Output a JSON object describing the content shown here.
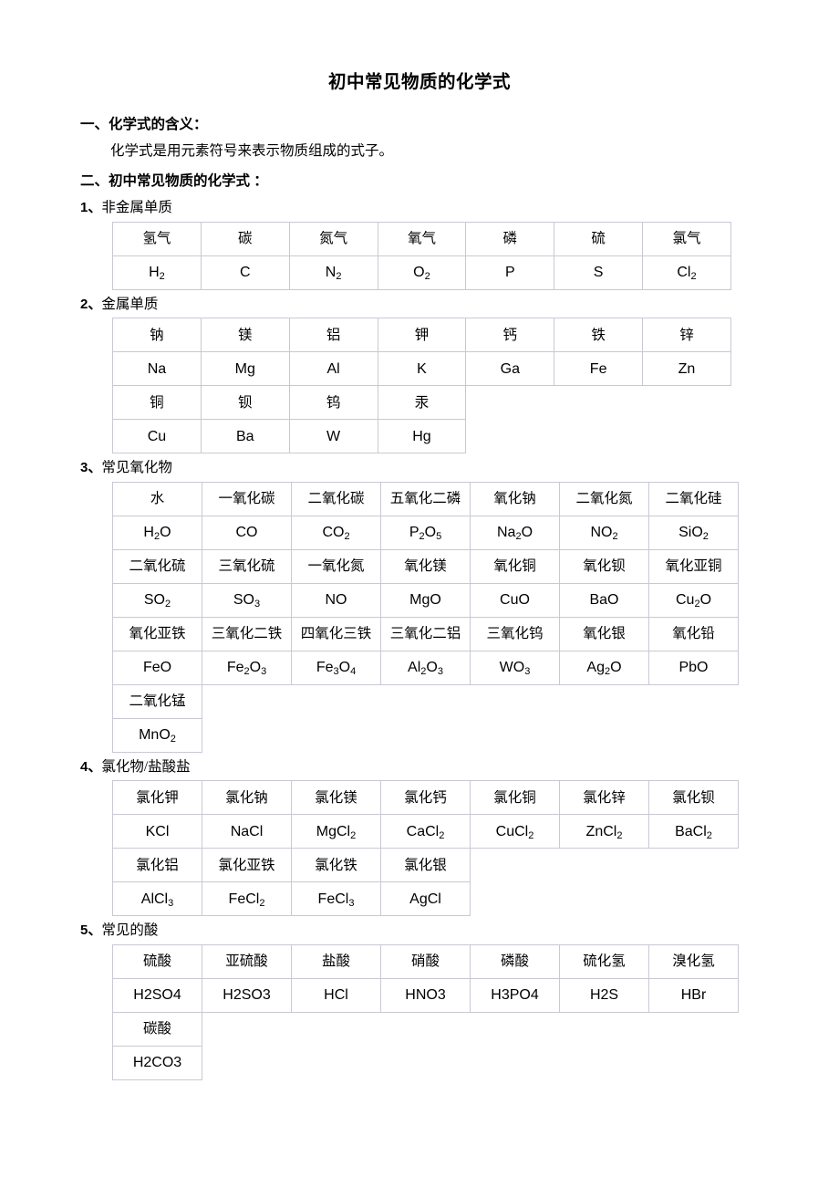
{
  "document": {
    "title": "初中常见物质的化学式",
    "sections": [
      {
        "heading": "一、化学式的含义：",
        "body": "化学式是用元素符号来表示物质组成的式子。"
      },
      {
        "heading": "二、初中常见物质的化学式 ："
      }
    ]
  },
  "groups": [
    {
      "number": "1、",
      "label": "非金属单质",
      "table_style": "wide",
      "rows": [
        {
          "names": [
            "氢气",
            "碳",
            "氮气",
            "氧气",
            "磷",
            "硫",
            "氯气"
          ],
          "formulas": [
            {
              "base": "H",
              "sub": "2"
            },
            {
              "base": "C",
              "sub": ""
            },
            {
              "base": "N",
              "sub": "2"
            },
            {
              "base": "O",
              "sub": "2"
            },
            {
              "base": "P",
              "sub": ""
            },
            {
              "base": "S",
              "sub": ""
            },
            {
              "base": "Cl",
              "sub": "2"
            }
          ]
        }
      ]
    },
    {
      "number": "2、",
      "label": "金属单质",
      "table_style": "wide",
      "rows": [
        {
          "names": [
            "钠",
            "镁",
            "铝",
            "钾",
            "钙",
            "铁",
            "锌"
          ],
          "formulas": [
            {
              "base": "Na",
              "sub": ""
            },
            {
              "base": "Mg",
              "sub": ""
            },
            {
              "base": "Al",
              "sub": ""
            },
            {
              "base": "K",
              "sub": ""
            },
            {
              "base": "Ga",
              "sub": ""
            },
            {
              "base": "Fe",
              "sub": ""
            },
            {
              "base": "Zn",
              "sub": ""
            }
          ]
        },
        {
          "names": [
            "铜",
            "钡",
            "钨",
            "汞"
          ],
          "formulas": [
            {
              "base": "Cu",
              "sub": ""
            },
            {
              "base": "Ba",
              "sub": ""
            },
            {
              "base": "W",
              "sub": ""
            },
            {
              "base": "Hg",
              "sub": ""
            }
          ]
        }
      ]
    },
    {
      "number": "3、",
      "label": "常见氧化物",
      "table_style": "narrow",
      "rows": [
        {
          "names": [
            "水",
            "一氧化碳",
            "二氧化碳",
            "五氧化二磷",
            "氧化钠",
            "二氧化氮",
            "二氧化硅"
          ],
          "formulas": [
            {
              "base": "H",
              "sub": "2",
              "tail": "O"
            },
            {
              "base": "CO",
              "sub": ""
            },
            {
              "base": "CO",
              "sub": "2"
            },
            {
              "base": "P",
              "sub": "2",
              "tail": "O",
              "sub2": "5"
            },
            {
              "base": "Na",
              "sub": "2",
              "tail": "O"
            },
            {
              "base": "NO",
              "sub": "2"
            },
            {
              "base": "SiO",
              "sub": "2"
            }
          ]
        },
        {
          "names": [
            "二氧化硫",
            "三氧化硫",
            "一氧化氮",
            "氧化镁",
            "氧化铜",
            "氧化钡",
            "氧化亚铜"
          ],
          "formulas": [
            {
              "base": "SO",
              "sub": "2"
            },
            {
              "base": "SO",
              "sub": "3"
            },
            {
              "base": "NO",
              "sub": ""
            },
            {
              "base": "MgO",
              "sub": ""
            },
            {
              "base": "CuO",
              "sub": ""
            },
            {
              "base": "BaO",
              "sub": ""
            },
            {
              "base": "Cu",
              "sub": "2",
              "tail": "O"
            }
          ]
        },
        {
          "names": [
            "氧化亚铁",
            "三氧化二铁",
            "四氧化三铁",
            "三氧化二铝",
            "三氧化钨",
            "氧化银",
            "氧化铅"
          ],
          "formulas": [
            {
              "base": "FeO",
              "sub": ""
            },
            {
              "base": "Fe",
              "sub": "2",
              "tail": "O",
              "sub2": "3"
            },
            {
              "base": "Fe",
              "sub": "3",
              "tail": "O",
              "sub2": "4"
            },
            {
              "base": "Al",
              "sub": "2",
              "tail": "O",
              "sub2": "3"
            },
            {
              "base": "WO",
              "sub": "3"
            },
            {
              "base": "Ag",
              "sub": "2",
              "tail": "O"
            },
            {
              "base": "PbO",
              "sub": ""
            }
          ]
        },
        {
          "names": [
            "二氧化锰"
          ],
          "formulas": [
            {
              "base": "MnO",
              "sub": "2"
            }
          ]
        }
      ]
    },
    {
      "number": "4、",
      "label": "氯化物/盐酸盐",
      "table_style": "narrow",
      "rows": [
        {
          "names": [
            "氯化钾",
            "氯化钠",
            "氯化镁",
            "氯化钙",
            "氯化铜",
            "氯化锌",
            "氯化钡"
          ],
          "formulas": [
            {
              "base": "KCl",
              "sub": ""
            },
            {
              "base": "NaCl",
              "sub": ""
            },
            {
              "base": "MgCl",
              "sub": "2"
            },
            {
              "base": "CaCl",
              "sub": "2"
            },
            {
              "base": "CuCl",
              "sub": "2"
            },
            {
              "base": "ZnCl",
              "sub": "2"
            },
            {
              "base": "BaCl",
              "sub": "2"
            }
          ]
        },
        {
          "names": [
            "氯化铝",
            "氯化亚铁",
            "氯化铁",
            "氯化银"
          ],
          "formulas": [
            {
              "base": "AlCl",
              "sub": "3"
            },
            {
              "base": "FeCl",
              "sub": "2"
            },
            {
              "base": "FeCl",
              "sub": "3"
            },
            {
              "base": "AgCl",
              "sub": ""
            }
          ]
        }
      ]
    },
    {
      "number": "5、",
      "label": "常见的酸",
      "table_style": "narrow",
      "rows": [
        {
          "names": [
            "硫酸",
            "亚硫酸",
            "盐酸",
            "硝酸",
            "磷酸",
            "硫化氢",
            "溴化氢"
          ],
          "formulas": [
            {
              "base": "H2SO4",
              "sub": ""
            },
            {
              "base": "H2SO3",
              "sub": ""
            },
            {
              "base": "HCl",
              "sub": ""
            },
            {
              "base": "HNO3",
              "sub": ""
            },
            {
              "base": "H3PO4",
              "sub": ""
            },
            {
              "base": "H2S",
              "sub": ""
            },
            {
              "base": "HBr",
              "sub": ""
            }
          ]
        },
        {
          "names": [
            "碳酸"
          ],
          "formulas": [
            {
              "base": "H2CO3",
              "sub": ""
            }
          ]
        }
      ]
    }
  ],
  "colors": {
    "border": "#c9c9d4",
    "text": "#000000",
    "background": "#ffffff"
  }
}
